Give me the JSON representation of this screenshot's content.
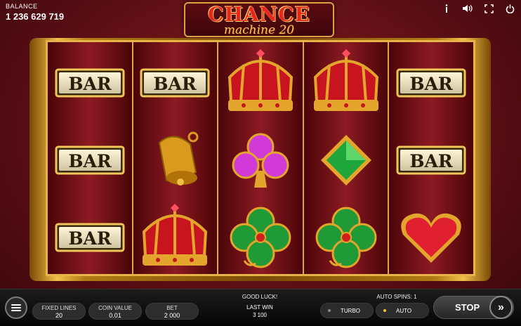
{
  "balance": {
    "label": "BALANCE",
    "value": "1 236 629 719"
  },
  "logo": {
    "title": "CHANCE",
    "subtitle": "machine 20"
  },
  "top_icons": [
    "info-icon",
    "sound-icon",
    "fullscreen-icon",
    "power-icon"
  ],
  "reels": [
    [
      "bar",
      "bar",
      "bar"
    ],
    [
      "bar",
      "bell",
      "crown"
    ],
    [
      "crown",
      "club",
      "clover"
    ],
    [
      "crown",
      "diamond",
      "clover"
    ],
    [
      "bar",
      "bar",
      "heart"
    ]
  ],
  "symbols": {
    "bar_text": "BAR"
  },
  "bottom_bar": {
    "fixed_lines": {
      "label": "FIXED LINES",
      "value": "20"
    },
    "coin_value": {
      "label": "COIN VALUE",
      "value": "0.01"
    },
    "bet": {
      "label": "BET",
      "value": "2 000"
    },
    "message": "GOOD LUCK!",
    "last_win": {
      "label": "LAST WIN",
      "value": "3 100"
    },
    "auto_spins": "AUTO SPINS: 1",
    "turbo_label": "TURBO",
    "auto_label": "AUTO",
    "stop_label": "STOP"
  },
  "colors": {
    "auto_dot": "#f2c230",
    "turbo_dot": "#888888",
    "reel_border": "#e8b347"
  }
}
